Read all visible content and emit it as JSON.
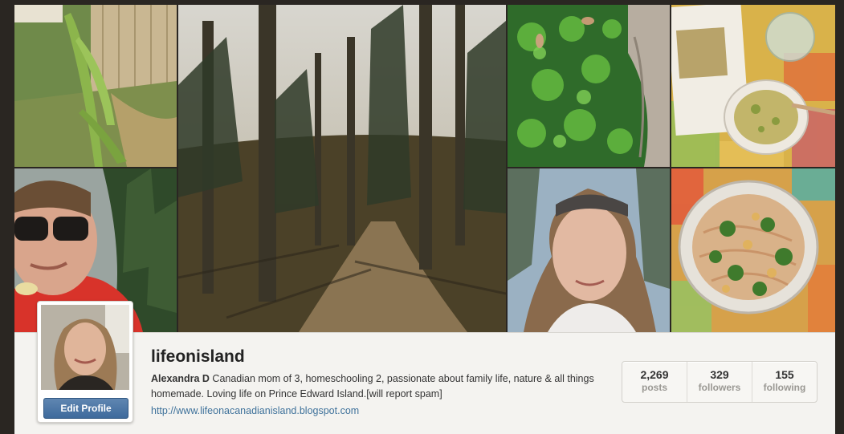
{
  "photo_grid": {
    "tiles": [
      {
        "name": "tulip-shoots-photo"
      },
      {
        "name": "forest-path-photo"
      },
      {
        "name": "moss-photo"
      },
      {
        "name": "quinoa-bowl-photo"
      },
      {
        "name": "selfie-sunglasses-photo"
      },
      {
        "name": "selfie-sunglasses-on-head-photo"
      },
      {
        "name": "noodle-bowl-photo"
      }
    ]
  },
  "profile": {
    "username": "lifeonisland",
    "display_name": "Alexandra D",
    "bio": " Canadian mom of 3, homeschooling 2, passionate about family life, nature & all things homemade. Loving life on Prince Edward Island.[will report spam]",
    "website": "http://www.lifeonacanadianisland.blogspot.com",
    "edit_button": "Edit Profile"
  },
  "stats": [
    {
      "value": "2,269",
      "label": "posts"
    },
    {
      "value": "329",
      "label": "followers"
    },
    {
      "value": "155",
      "label": "following"
    }
  ]
}
